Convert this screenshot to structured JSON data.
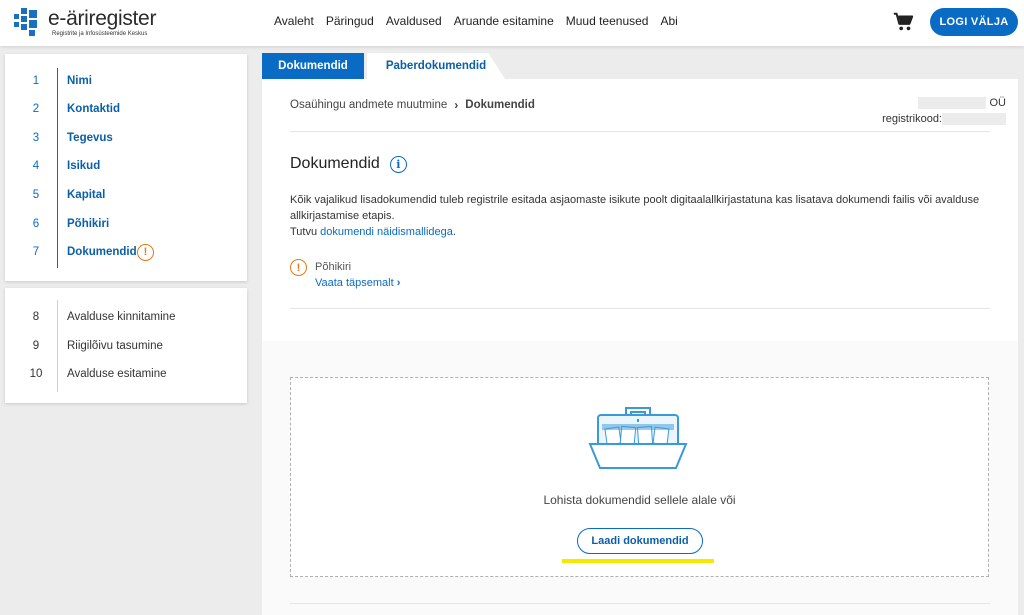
{
  "header": {
    "logo_title": "e-äriregister",
    "logo_subtitle": "Registrite ja Infosüsteemide Keskus",
    "nav": [
      "Avaleht",
      "Päringud",
      "Avaldused",
      "Aruande esitamine",
      "Muud teenused",
      "Abi"
    ],
    "cart_icon": "shopping-cart-icon",
    "logout_label": "LOGI VÄLJA"
  },
  "steps_main": [
    {
      "num": "1",
      "label": "Nimi"
    },
    {
      "num": "2",
      "label": "Kontaktid"
    },
    {
      "num": "3",
      "label": "Tegevus"
    },
    {
      "num": "4",
      "label": "Isikud"
    },
    {
      "num": "5",
      "label": "Kapital"
    },
    {
      "num": "6",
      "label": "Põhikiri"
    },
    {
      "num": "7",
      "label": "Dokumendid"
    }
  ],
  "steps_final": [
    {
      "num": "8",
      "label": "Avalduse kinnitamine"
    },
    {
      "num": "9",
      "label": "Riigilõivu tasumine"
    },
    {
      "num": "10",
      "label": "Avalduse esitamine"
    }
  ],
  "tabs": {
    "active": "Dokumendid",
    "inactive": "Paberdokumendid"
  },
  "breadcrumb": {
    "parent": "Osaühingu andmete muutmine",
    "current": "Dokumendid"
  },
  "company": {
    "suffix": "OÜ",
    "reg_label": "registrikood:"
  },
  "section": {
    "title": "Dokumendid",
    "desc_line": "Kõik vajalikud lisadokumendid tuleb registrile esitada asjaomaste isikute poolt digitaalallkirjastatuna kas lisatava dokumendi failis või avalduse allkirjastamise etapis.",
    "templates_prefix": "Tutvu ",
    "templates_link": "dokumendi näidismallidega",
    "templates_suffix": "."
  },
  "warning": {
    "name": "Põhikiri",
    "more": "Vaata täpsemalt"
  },
  "dropzone": {
    "text": "Lohista dokumendid sellele alale või",
    "button": "Laadi dokumendid"
  },
  "colors": {
    "accent": "#0a6bc4",
    "warning": "#e07b1f",
    "highlight": "#f5e900"
  }
}
